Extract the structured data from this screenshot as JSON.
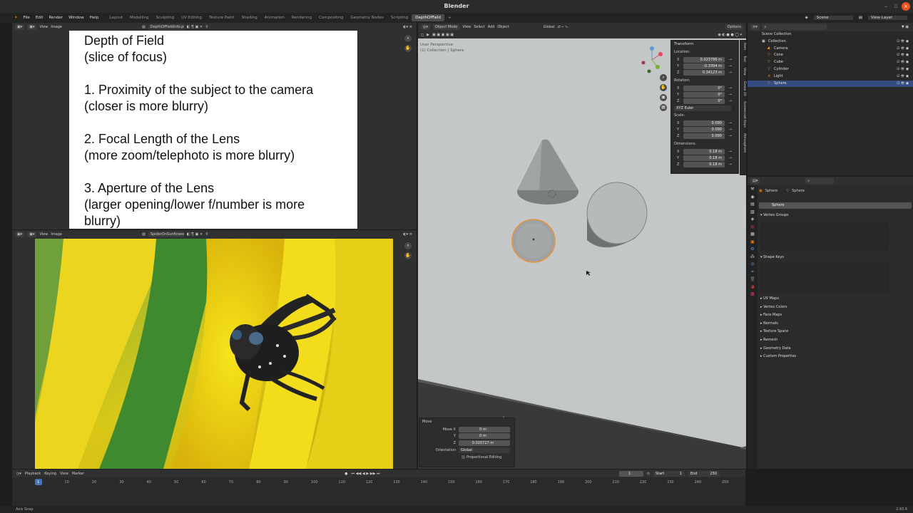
{
  "window": {
    "title": "Blender"
  },
  "menu": [
    "File",
    "Edit",
    "Render",
    "Window",
    "Help"
  ],
  "workspaces": [
    "Layout",
    "Modelling",
    "Sculpting",
    "UV Editing",
    "Texture Paint",
    "Shading",
    "Animation",
    "Rendering",
    "Compositing",
    "Geometry Nodes",
    "Scripting",
    "DepthOfField"
  ],
  "editor_doc": {
    "view": "View",
    "image": "Image",
    "filename": "DepthOfFieldInfo.png",
    "lines": [
      "Depth of Field",
      "(slice of focus)",
      "",
      "1. Proximity of the subject to the camera",
      "(closer is more blurry)",
      "",
      "2. Focal Length of the Lens",
      "(more zoom/telephoto is more blurry)",
      "",
      "3. Aperture of the Lens",
      "(larger opening/lower f/number is more",
      "blurry)"
    ]
  },
  "editor_photo": {
    "view": "View",
    "image": "Image",
    "filename": "SpiderOnSunflower.jpg"
  },
  "viewport": {
    "mode": "Object Mode",
    "menus": [
      "View",
      "Select",
      "Add",
      "Object"
    ],
    "orientation": "Global",
    "options": "Options",
    "overlay_title": "User Perspective",
    "overlay_sub": "(1) Collection | Sphere"
  },
  "npanel": {
    "tabs": [
      "Item",
      "Tool",
      "View",
      "Grove 10",
      "Screencast Keys",
      "Atmosphere"
    ],
    "transform": "Transform",
    "location_label": "Location:",
    "location": [
      {
        "axis": "X",
        "value": "0.023786 m"
      },
      {
        "axis": "Y",
        "value": "-0.3394 m"
      },
      {
        "axis": "Z",
        "value": "0.34123 m"
      }
    ],
    "rotation_label": "Rotation:",
    "rotation": [
      {
        "axis": "X",
        "value": "0°"
      },
      {
        "axis": "Y",
        "value": "0°"
      },
      {
        "axis": "Z",
        "value": "0°"
      }
    ],
    "rotation_mode": "XYZ Euler",
    "scale_label": "Scale:",
    "scale": [
      {
        "axis": "X",
        "value": "0.090"
      },
      {
        "axis": "Y",
        "value": "0.090"
      },
      {
        "axis": "Z",
        "value": "0.090"
      }
    ],
    "dimensions_label": "Dimensions:",
    "dimensions": [
      {
        "axis": "X",
        "value": "0.18 m"
      },
      {
        "axis": "Y",
        "value": "0.18 m"
      },
      {
        "axis": "Z",
        "value": "0.18 m"
      }
    ]
  },
  "move_panel": {
    "title": "Move",
    "rows": [
      {
        "label": "Move X",
        "value": "0 m"
      },
      {
        "label": "Y",
        "value": "0 m"
      },
      {
        "label": "Z",
        "value": "0.020727 m"
      }
    ],
    "orientation_label": "Orientation",
    "orientation_value": "Global",
    "proportional": "Proportional Editing"
  },
  "outliner": {
    "scene": "Scene",
    "view_layer": "View Layer",
    "root": "Scene Collection",
    "items": [
      {
        "name": "Collection",
        "indent": 0
      },
      {
        "name": "Camera",
        "indent": 1
      },
      {
        "name": "Cone",
        "indent": 1
      },
      {
        "name": "Cube",
        "indent": 1
      },
      {
        "name": "Cylinder",
        "indent": 1
      },
      {
        "name": "Light",
        "indent": 1
      },
      {
        "name": "Sphere",
        "indent": 1,
        "selected": true
      }
    ]
  },
  "properties": {
    "object": "Sphere",
    "data": "Sphere",
    "mesh_name": "Sphere",
    "dynamic_tab": "Dynamic Paint",
    "vertex_groups": "Vertex Groups",
    "shape_keys": "Shape Keys",
    "sections": [
      "UV Maps",
      "Vertex Colors",
      "Face Maps",
      "Normals",
      "Texture Space",
      "Remesh",
      "Geometry Data",
      "Custom Properties"
    ]
  },
  "timeline": {
    "menus": [
      "Playback",
      "Keying",
      "View",
      "Marker"
    ],
    "current_frame": "1",
    "start_label": "Start",
    "start": "1",
    "end_label": "End",
    "end": "250",
    "ticks": [
      "1",
      "10",
      "20",
      "30",
      "40",
      "50",
      "60",
      "70",
      "80",
      "90",
      "100",
      "110",
      "120",
      "130",
      "140",
      "150",
      "160",
      "170",
      "180",
      "190",
      "200",
      "210",
      "220",
      "230",
      "240",
      "250"
    ]
  },
  "status": {
    "left": "Axis Snap",
    "version": "2.93.6"
  },
  "colors": {
    "selection": "#e8913c",
    "active_workspace": "#4b4b4b",
    "background": "#303030"
  }
}
